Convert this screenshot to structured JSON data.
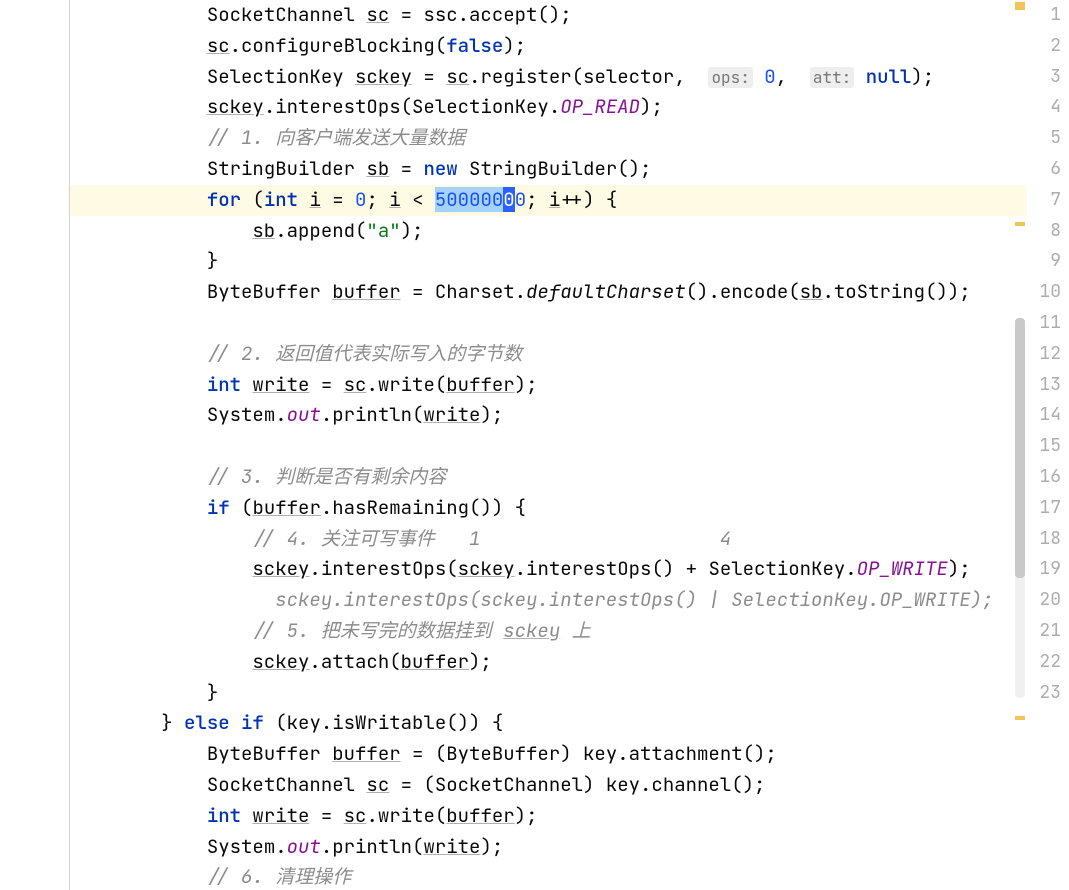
{
  "editor": {
    "line_start": 1,
    "line_end": 23,
    "has_warning_stripe_top": true,
    "has_warning_stripe_mid": true,
    "has_warning_stripe_bottom": true
  },
  "code": {
    "l1_a": "SocketChannel ",
    "l1_var": "sc",
    "l1_b": " = ssc.accept();",
    "l2_a": "sc",
    "l2_b": ".configureBlocking(",
    "l2_c": "false",
    "l2_d": ");",
    "l3_a": "SelectionKey ",
    "l3_var": "sckey",
    "l3_b": " = ",
    "l3_c": "sc",
    "l3_d": ".register(selector,  ",
    "l3_hint1": "ops:",
    "l3_e": " ",
    "l3_num": "0",
    "l3_f": ",  ",
    "l3_hint2": "att:",
    "l3_g": " ",
    "l3_null": "null",
    "l3_h": ");",
    "l4_a": "sckey",
    "l4_b": ".interestOps(SelectionKey.",
    "l4_c": "OP_READ",
    "l4_d": ");",
    "l5": "// 1. 向客户端发送大量数据",
    "l6_a": "StringBuilder ",
    "l6_var": "sb",
    "l6_b": " = ",
    "l6_new": "new",
    "l6_c": " StringBuilder();",
    "l7_a": "for",
    "l7_b": " (",
    "l7_int": "int",
    "l7_c": " ",
    "l7_i1": "i",
    "l7_d": " = ",
    "l7_zero": "0",
    "l7_e": "; ",
    "l7_i2": "i",
    "l7_f": " < ",
    "l7_sel1": "500000",
    "l7_sel2": "0",
    "l7_after": "0",
    "l7_g": "; ",
    "l7_i3": "i",
    "l7_h": "++) {",
    "l8_a": "sb",
    "l8_b": ".append(",
    "l8_str": "\"a\"",
    "l8_c": ");",
    "l9": "}",
    "l10_a": "ByteBuffer ",
    "l10_var": "buffer",
    "l10_b": " = Charset.",
    "l10_m": "defaultCharset",
    "l10_c": "().encode(",
    "l10_d": "sb",
    "l10_e": ".toString());",
    "l12": "// 2. 返回值代表实际写入的字节数",
    "l13_a": "int",
    "l13_b": " ",
    "l13_var": "write",
    "l13_c": " = ",
    "l13_d": "sc",
    "l13_e": ".write(",
    "l13_f": "buffer",
    "l13_g": ");",
    "l14_a": "System.",
    "l14_out": "out",
    "l14_b": ".println(",
    "l14_c": "write",
    "l14_d": ");",
    "l16": "// 3. 判断是否有剩余内容",
    "l17_a": "if",
    "l17_b": " (",
    "l17_c": "buffer",
    "l17_d": ".hasRemaining()) {",
    "l18": "// 4. 关注可写事件   1                     4",
    "l19_a": "sckey",
    "l19_b": ".interestOps(",
    "l19_c": "sckey",
    "l19_d": ".interestOps() + SelectionKey.",
    "l19_e": "OP_WRITE",
    "l19_f": ");",
    "l20": "sckey.interestOps(sckey.interestOps() | SelectionKey.OP_WRITE);",
    "l21_a": "// 5. 把未写完的数据挂到 ",
    "l21_b": "sckey",
    "l21_c": " 上",
    "l22_a": "sckey",
    "l22_b": ".attach(",
    "l22_c": "buffer",
    "l22_d": ");",
    "l23": "}",
    "l24_a": "} ",
    "l24_else": "else",
    "l24_b": " ",
    "l24_if": "if",
    "l24_c": " (key.isWritable()) {",
    "l25_a": "ByteBuffer ",
    "l25_var": "buffer",
    "l25_b": " = (ByteBuffer) key.attachment();",
    "l26_a": "SocketChannel ",
    "l26_var": "sc",
    "l26_b": " = (SocketChannel) key.channel();",
    "l27_a": "int",
    "l27_b": " ",
    "l27_var": "write",
    "l27_c": " = ",
    "l27_d": "sc",
    "l27_e": ".write(",
    "l27_f": "buffer",
    "l27_g": ");",
    "l28_a": "System.",
    "l28_out": "out",
    "l28_b": ".println(",
    "l28_c": "write",
    "l28_d": ");",
    "l29": "// 6. 清理操作"
  },
  "line_numbers": [
    "1",
    "2",
    "3",
    "4",
    "5",
    "6",
    "7",
    "8",
    "9",
    "10",
    "11",
    "12",
    "13",
    "14",
    "15",
    "16",
    "17",
    "18",
    "19",
    "20",
    "21",
    "22",
    "23"
  ]
}
